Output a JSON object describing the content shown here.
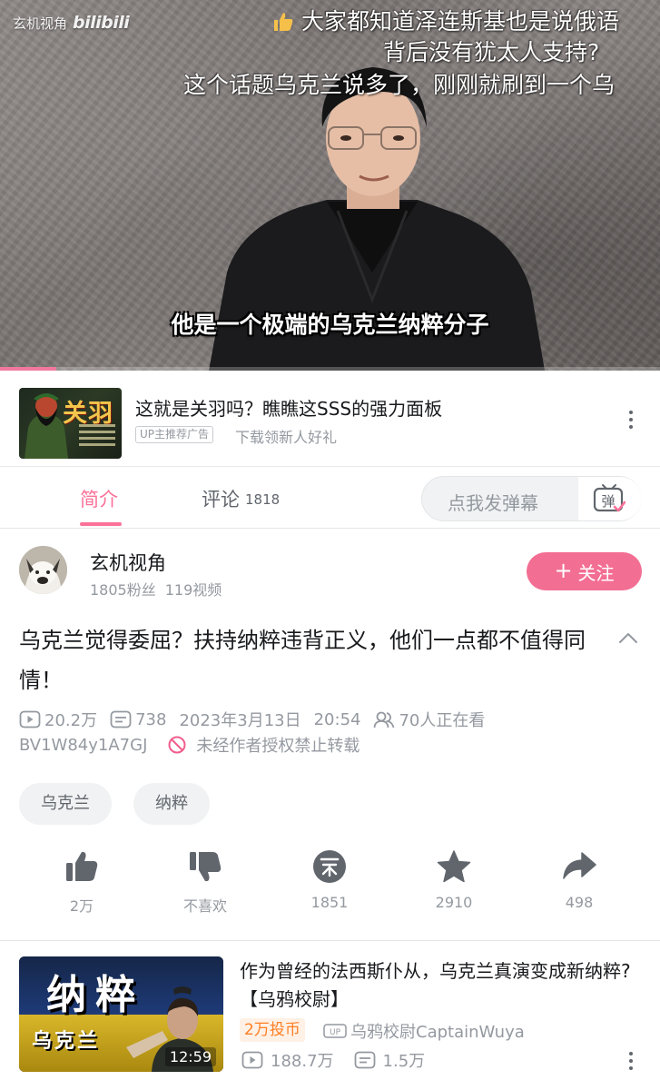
{
  "player": {
    "channel_watermark": "玄机视角",
    "platform_logo": "bilibili",
    "danmaku": [
      "大家都知道泽连斯基也是说俄语",
      "背后没有犹太人支持?",
      "这个话题乌克兰说多了，刚刚就刷到一个乌"
    ],
    "subtitle": "他是一个极端的乌克兰纳粹分子",
    "progress": 0.085,
    "accent_color": "#f1789e"
  },
  "ad": {
    "thumb_glyph": "关羽",
    "title": "这就是关羽吗？瞧瞧这SSS的强力面板",
    "tag": "UP主推荐广告",
    "subtitle": "下载领新人好礼",
    "menu_icon": "more-vertical-icon"
  },
  "tabs": {
    "intro": "简介",
    "comments": "评论",
    "comments_count": "1818",
    "danmu_placeholder": "点我发弹幕",
    "danmu_icon": "danmu-tv-icon",
    "active_color": "#fb7299"
  },
  "author": {
    "name": "玄机视角",
    "followers": "1805粉丝",
    "videos": "119视频",
    "follow_label": "关注",
    "follow_color": "#f36e93"
  },
  "video": {
    "title": "乌克兰觉得委屈？扶持纳粹违背正义，他们一点都不值得同情！",
    "views": "20.2万",
    "danmaku_count": "738",
    "date": "2023年3月13日",
    "time": "20:54",
    "watching": "70人正在看",
    "bvid": "BV1W84y1A7GJ",
    "copyright": "未经作者授权禁止转载"
  },
  "tags": [
    "乌克兰",
    "纳粹"
  ],
  "actions": [
    {
      "icon": "thumb-up-icon",
      "label": "2万"
    },
    {
      "icon": "thumb-down-icon",
      "label": "不喜欢"
    },
    {
      "icon": "coin-icon",
      "label": "1851"
    },
    {
      "icon": "star-icon",
      "label": "2910"
    },
    {
      "icon": "share-icon",
      "label": "498"
    }
  ],
  "recommended": {
    "thumb_text_top": "纳粹",
    "thumb_text_bottom": "乌克兰",
    "duration": "12:59",
    "title": "作为曾经的法西斯仆从，乌克兰真演变成新纳粹?【乌鸦校尉】",
    "badge": "2万投币",
    "up_name": "乌鸦校尉CaptainWuya",
    "views": "188.7万",
    "danmaku": "1.5万"
  }
}
